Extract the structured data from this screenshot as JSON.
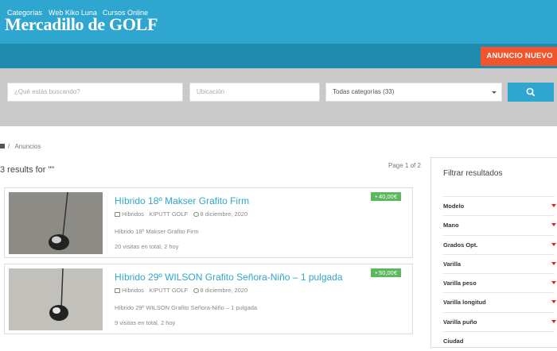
{
  "site": {
    "logo": "Mercadillo de GOLF"
  },
  "nav": {
    "items": [
      {
        "label": "Categorías"
      },
      {
        "label": "Web Kiko Luna"
      },
      {
        "label": "Cursos Online"
      }
    ],
    "cta": "ANUNCIO NUEVO"
  },
  "search": {
    "query_placeholder": "¿Qué estás buscando?",
    "location_placeholder": "Ubicación",
    "category_selected": "Todas categorías (33)"
  },
  "breadcrumb": {
    "current": "Anuncios"
  },
  "results": {
    "title": "3 results for \"\"",
    "page_info": "Page 1 of 2"
  },
  "listings": [
    {
      "title": "Híbrido 18º Makser Grafito Firm",
      "category": "Híbridos",
      "seller": "KIPUTT GOLF",
      "date": "8 diciembre, 2020",
      "description": "Híbrido 18º Makser Grafito Firm",
      "visits": "20 visitas en total, 2 hoy",
      "price": "40,00€"
    },
    {
      "title": "Híbrido 29º WILSON Grafito Señora-Niño – 1 pulgada",
      "category": "Híbridos",
      "seller": "KIPUTT GOLF",
      "date": "8 diciembre, 2020",
      "description": "Híbrido 29º WILSON Grafito Señora-Niño – 1 pulgada",
      "visits": "9 visitas en total, 2 hoy",
      "price": "50,00€"
    }
  ],
  "sidebar": {
    "title": "Filtrar resultados",
    "filters": [
      {
        "label": "Modelo"
      },
      {
        "label": "Mano"
      },
      {
        "label": "Grados Opt."
      },
      {
        "label": "Varilla"
      },
      {
        "label": "Varilla peso"
      },
      {
        "label": "Varilla longitud"
      },
      {
        "label": "Varilla puño"
      },
      {
        "label": "Ciudad"
      }
    ]
  },
  "colors": {
    "header": "#2ea6cf",
    "nav": "#1f8bae",
    "cta": "#f2552c",
    "price": "#5cb85c",
    "filter_arrow": "#d9242b"
  }
}
